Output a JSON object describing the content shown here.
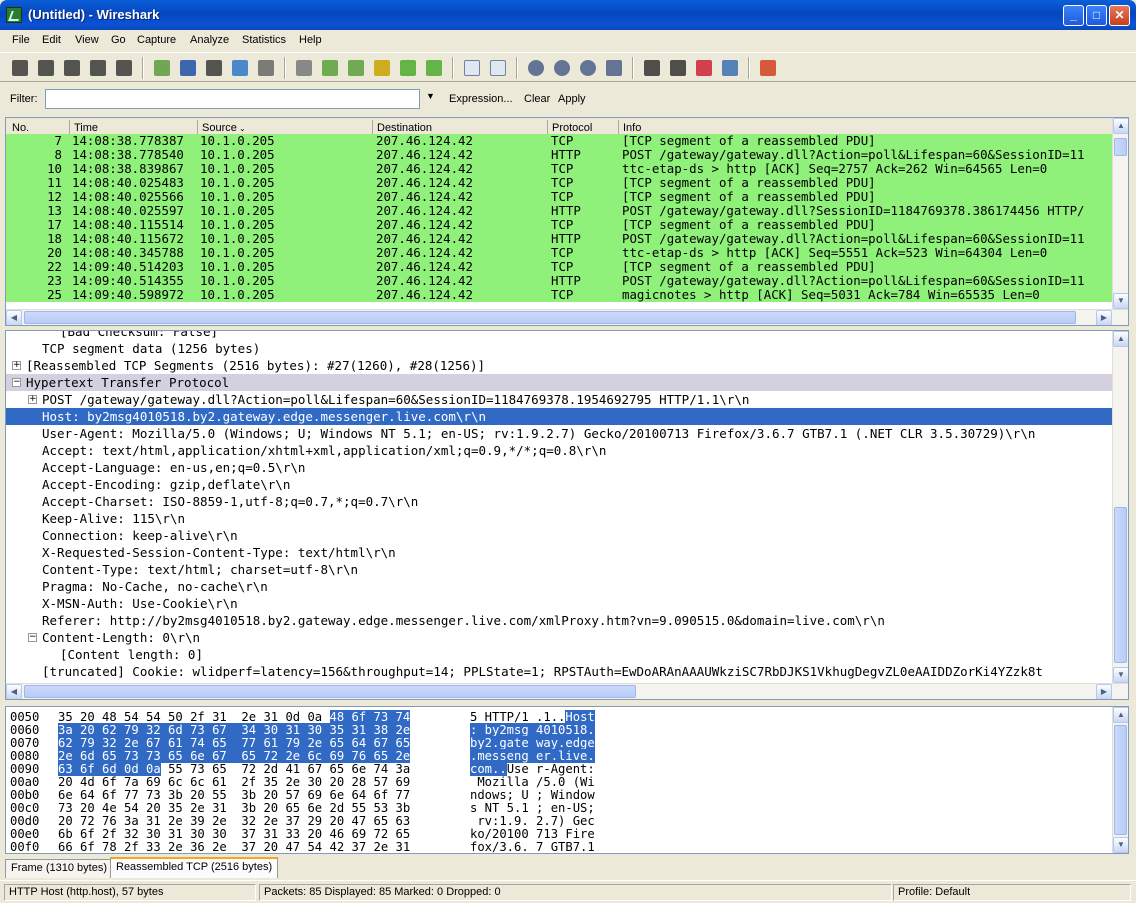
{
  "window": {
    "title": "(Untitled) - Wireshark",
    "min": "_",
    "max": "□",
    "close": "✕"
  },
  "menu": [
    "File",
    "Edit",
    "View",
    "Go",
    "Capture",
    "Analyze",
    "Statistics",
    "Help"
  ],
  "filter": {
    "label": "Filter:",
    "value": "",
    "expression": "Expression...",
    "clear": "Clear",
    "apply": "Apply"
  },
  "packet_list": {
    "columns": [
      "No.",
      "Time",
      "Source",
      "Destination",
      "Protocol",
      "Info"
    ],
    "rows": [
      {
        "no": "7",
        "time": "14:08:38.778387",
        "src": "10.1.0.205",
        "dst": "207.46.124.42",
        "proto": "TCP",
        "info": "[TCP segment of a reassembled PDU]"
      },
      {
        "no": "8",
        "time": "14:08:38.778540",
        "src": "10.1.0.205",
        "dst": "207.46.124.42",
        "proto": "HTTP",
        "info": "POST /gateway/gateway.dll?Action=poll&Lifespan=60&SessionID=11"
      },
      {
        "no": "10",
        "time": "14:08:38.839867",
        "src": "10.1.0.205",
        "dst": "207.46.124.42",
        "proto": "TCP",
        "info": "ttc-etap-ds > http [ACK] Seq=2757 Ack=262 Win=64565 Len=0"
      },
      {
        "no": "11",
        "time": "14:08:40.025483",
        "src": "10.1.0.205",
        "dst": "207.46.124.42",
        "proto": "TCP",
        "info": "[TCP segment of a reassembled PDU]"
      },
      {
        "no": "12",
        "time": "14:08:40.025566",
        "src": "10.1.0.205",
        "dst": "207.46.124.42",
        "proto": "TCP",
        "info": "[TCP segment of a reassembled PDU]"
      },
      {
        "no": "13",
        "time": "14:08:40.025597",
        "src": "10.1.0.205",
        "dst": "207.46.124.42",
        "proto": "HTTP",
        "info": "POST /gateway/gateway.dll?SessionID=1184769378.386174456 HTTP/"
      },
      {
        "no": "17",
        "time": "14:08:40.115514",
        "src": "10.1.0.205",
        "dst": "207.46.124.42",
        "proto": "TCP",
        "info": "[TCP segment of a reassembled PDU]"
      },
      {
        "no": "18",
        "time": "14:08:40.115672",
        "src": "10.1.0.205",
        "dst": "207.46.124.42",
        "proto": "HTTP",
        "info": "POST /gateway/gateway.dll?Action=poll&Lifespan=60&SessionID=11"
      },
      {
        "no": "20",
        "time": "14:08:40.345788",
        "src": "10.1.0.205",
        "dst": "207.46.124.42",
        "proto": "TCP",
        "info": "ttc-etap-ds > http [ACK] Seq=5551 Ack=523 Win=64304 Len=0"
      },
      {
        "no": "22",
        "time": "14:09:40.514203",
        "src": "10.1.0.205",
        "dst": "207.46.124.42",
        "proto": "TCP",
        "info": "[TCP segment of a reassembled PDU]"
      },
      {
        "no": "23",
        "time": "14:09:40.514355",
        "src": "10.1.0.205",
        "dst": "207.46.124.42",
        "proto": "HTTP",
        "info": "POST /gateway/gateway.dll?Action=poll&Lifespan=60&SessionID=11"
      },
      {
        "no": "25",
        "time": "14:09:40.598972",
        "src": "10.1.0.205",
        "dst": "207.46.124.42",
        "proto": "TCP",
        "info": "magicnotes > http [ACK] Seq=5031 Ack=784 Win=65535 Len=0"
      }
    ]
  },
  "details": [
    {
      "text": "[Bad Checksum: False]",
      "indent": 2,
      "exp": "",
      "hl": ""
    },
    {
      "text": "TCP segment data (1256 bytes)",
      "indent": 1,
      "exp": "",
      "hl": ""
    },
    {
      "text": "[Reassembled TCP Segments (2516 bytes): #27(1260), #28(1256)]",
      "indent": 0,
      "exp": "+",
      "hl": ""
    },
    {
      "text": "Hypertext Transfer Protocol",
      "indent": 0,
      "exp": "-",
      "hl": "grey"
    },
    {
      "text": "POST /gateway/gateway.dll?Action=poll&Lifespan=60&SessionID=1184769378.1954692795 HTTP/1.1\\r\\n",
      "indent": 1,
      "exp": "+",
      "hl": ""
    },
    {
      "text": "Host: by2msg4010518.by2.gateway.edge.messenger.live.com\\r\\n",
      "indent": 1,
      "exp": "",
      "hl": "blue"
    },
    {
      "text": "User-Agent: Mozilla/5.0 (Windows; U; Windows NT 5.1; en-US; rv:1.9.2.7) Gecko/20100713 Firefox/3.6.7 GTB7.1 (.NET CLR 3.5.30729)\\r\\n",
      "indent": 1,
      "exp": "",
      "hl": ""
    },
    {
      "text": "Accept: text/html,application/xhtml+xml,application/xml;q=0.9,*/*;q=0.8\\r\\n",
      "indent": 1,
      "exp": "",
      "hl": ""
    },
    {
      "text": "Accept-Language: en-us,en;q=0.5\\r\\n",
      "indent": 1,
      "exp": "",
      "hl": ""
    },
    {
      "text": "Accept-Encoding: gzip,deflate\\r\\n",
      "indent": 1,
      "exp": "",
      "hl": ""
    },
    {
      "text": "Accept-Charset: ISO-8859-1,utf-8;q=0.7,*;q=0.7\\r\\n",
      "indent": 1,
      "exp": "",
      "hl": ""
    },
    {
      "text": "Keep-Alive: 115\\r\\n",
      "indent": 1,
      "exp": "",
      "hl": ""
    },
    {
      "text": "Connection: keep-alive\\r\\n",
      "indent": 1,
      "exp": "",
      "hl": ""
    },
    {
      "text": "X-Requested-Session-Content-Type: text/html\\r\\n",
      "indent": 1,
      "exp": "",
      "hl": ""
    },
    {
      "text": "Content-Type: text/html; charset=utf-8\\r\\n",
      "indent": 1,
      "exp": "",
      "hl": ""
    },
    {
      "text": "Pragma: No-Cache, no-cache\\r\\n",
      "indent": 1,
      "exp": "",
      "hl": ""
    },
    {
      "text": "X-MSN-Auth: Use-Cookie\\r\\n",
      "indent": 1,
      "exp": "",
      "hl": ""
    },
    {
      "text": "Referer: http://by2msg4010518.by2.gateway.edge.messenger.live.com/xmlProxy.htm?vn=9.090515.0&domain=live.com\\r\\n",
      "indent": 1,
      "exp": "",
      "hl": ""
    },
    {
      "text": "Content-Length: 0\\r\\n",
      "indent": 1,
      "exp": "-",
      "hl": ""
    },
    {
      "text": "[Content length: 0]",
      "indent": 2,
      "exp": "",
      "hl": ""
    },
    {
      "text": "[truncated] Cookie: wlidperf=latency=156&throughput=14; PPLState=1; RPSTAuth=EwDoARAnAAAUWkziSC7RbDJKS1VkhugDegvZL0eAAIDDZorKi4YZzk8t",
      "indent": 1,
      "exp": "",
      "hl": ""
    }
  ],
  "hex": [
    {
      "off": "0050",
      "pre": "35 20 48 54 54 50 2f 31  2e 31 0d 0a ",
      "sel": "48 6f 73 74",
      "post": "",
      "apre": "5 HTTP/1 .1..",
      "asel": "Host",
      "apost": ""
    },
    {
      "off": "0060",
      "pre": "",
      "sel": "3a 20 62 79 32 6d 73 67  34 30 31 30 35 31 38 2e",
      "post": "",
      "apre": "",
      "asel": ": by2msg 4010518.",
      "apost": ""
    },
    {
      "off": "0070",
      "pre": "",
      "sel": "62 79 32 2e 67 61 74 65  77 61 79 2e 65 64 67 65",
      "post": "",
      "apre": "",
      "asel": "by2.gate way.edge",
      "apost": ""
    },
    {
      "off": "0080",
      "pre": "",
      "sel": "2e 6d 65 73 73 65 6e 67  65 72 2e 6c 69 76 65 2e",
      "post": "",
      "apre": "",
      "asel": ".messeng er.live.",
      "apost": ""
    },
    {
      "off": "0090",
      "pre": "",
      "sel": "63 6f 6d 0d 0a",
      "post": " 55 73 65  72 2d 41 67 65 6e 74 3a",
      "apre": "",
      "asel": "com..",
      "apost": "Use r-Agent:"
    },
    {
      "off": "00a0",
      "pre": "20 4d 6f 7a 69 6c 6c 61  2f 35 2e 30 20 28 57 69",
      "sel": "",
      "post": "",
      "apre": " Mozilla /5.0 (Wi",
      "asel": "",
      "apost": ""
    },
    {
      "off": "00b0",
      "pre": "6e 64 6f 77 73 3b 20 55  3b 20 57 69 6e 64 6f 77",
      "sel": "",
      "post": "",
      "apre": "ndows; U ; Window",
      "asel": "",
      "apost": ""
    },
    {
      "off": "00c0",
      "pre": "73 20 4e 54 20 35 2e 31  3b 20 65 6e 2d 55 53 3b",
      "sel": "",
      "post": "",
      "apre": "s NT 5.1 ; en-US;",
      "asel": "",
      "apost": ""
    },
    {
      "off": "00d0",
      "pre": "20 72 76 3a 31 2e 39 2e  32 2e 37 29 20 47 65 63",
      "sel": "",
      "post": "",
      "apre": " rv:1.9. 2.7) Gec",
      "asel": "",
      "apost": ""
    },
    {
      "off": "00e0",
      "pre": "6b 6f 2f 32 30 31 30 30  37 31 33 20 46 69 72 65",
      "sel": "",
      "post": "",
      "apre": "ko/20100 713 Fire",
      "asel": "",
      "apost": ""
    },
    {
      "off": "00f0",
      "pre": "66 6f 78 2f 33 2e 36 2e  37 20 47 54 42 37 2e 31",
      "sel": "",
      "post": "",
      "apre": "fox/3.6. 7 GTB7.1",
      "asel": "",
      "apost": ""
    }
  ],
  "tabs": [
    "Frame (1310 bytes)",
    "Reassembled TCP (2516 bytes)"
  ],
  "status": {
    "field": "HTTP Host (http.host), 57 bytes",
    "packets": "Packets: 85 Displayed: 85 Marked: 0 Dropped: 0",
    "profile": "Profile: Default"
  },
  "toolbar_icons": [
    "interface-list-icon",
    "capture-options-icon",
    "capture-start-icon",
    "capture-stop-icon",
    "capture-restart-icon",
    "open-file-icon",
    "save-file-icon",
    "close-file-icon",
    "reload-icon",
    "print-icon",
    "find-icon",
    "back-icon",
    "forward-icon",
    "goto-packet-icon",
    "first-packet-icon",
    "last-packet-icon",
    "colorize-icon",
    "autoscroll-icon",
    "zoom-in-icon",
    "zoom-out-icon",
    "zoom-normal-icon",
    "resize-columns-icon",
    "capture-filters-icon",
    "display-filters-icon",
    "coloring-rules-icon",
    "preferences-icon",
    "help-icon"
  ],
  "colors": {
    "tcp_row": "#8ff07a",
    "selection": "#316ac5"
  }
}
